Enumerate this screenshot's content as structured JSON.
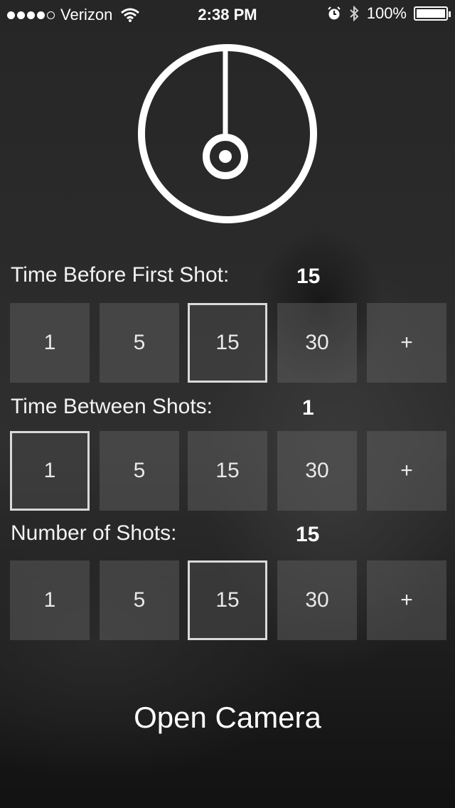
{
  "status_bar": {
    "carrier": "Verizon",
    "time": "2:38 PM",
    "battery": "100%",
    "icons": [
      "signal-dots-icon",
      "wifi-icon",
      "alarm-icon",
      "bluetooth-icon",
      "battery-icon"
    ]
  },
  "dial": {
    "icon": "timer-dial-icon"
  },
  "sections": [
    {
      "label": "Time Before First Shot:",
      "value": "15",
      "options": [
        "1",
        "5",
        "15",
        "30",
        "+"
      ],
      "selected": 2
    },
    {
      "label": "Time Between Shots:",
      "value": "1",
      "options": [
        "1",
        "5",
        "15",
        "30",
        "+"
      ],
      "selected": 0
    },
    {
      "label": "Number of Shots:",
      "value": "15",
      "options": [
        "1",
        "5",
        "15",
        "30",
        "+"
      ],
      "selected": 2
    }
  ],
  "open_camera_label": "Open Camera"
}
